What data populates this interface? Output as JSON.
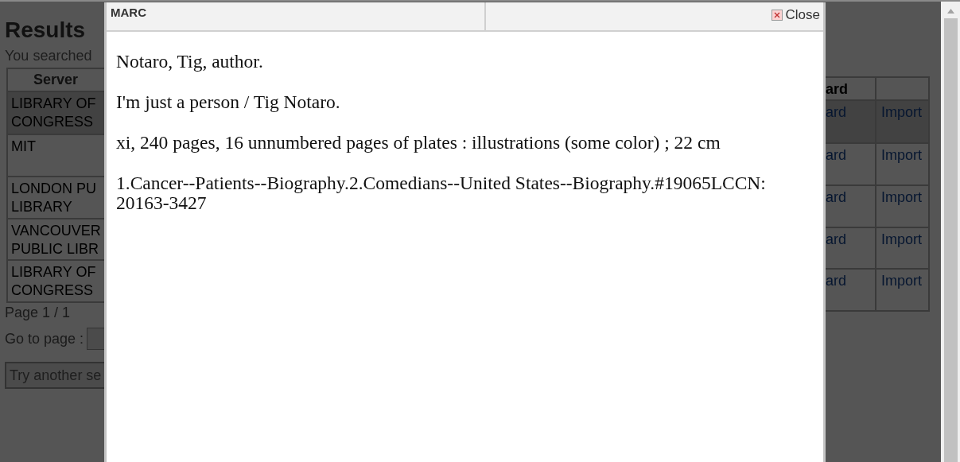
{
  "results": {
    "title": "Results",
    "search_summary": "You searched",
    "columns": {
      "server": "Server",
      "record": "ard"
    },
    "rows": [
      {
        "server": [
          "LIBRARY OF",
          "CONGRESS"
        ],
        "record": "ard",
        "action": "Import",
        "selected": true
      },
      {
        "server": [
          "MIT"
        ],
        "record": "ard",
        "action": "Import",
        "selected": false
      },
      {
        "server": [
          "LONDON PU",
          "LIBRARY"
        ],
        "record": "ard",
        "action": "Import",
        "selected": false
      },
      {
        "server": [
          "VANCOUVER",
          "PUBLIC LIBR"
        ],
        "record": "ard",
        "action": "Import",
        "selected": false
      },
      {
        "server": [
          "LIBRARY OF",
          "CONGRESS"
        ],
        "record": "ard",
        "action": "Import",
        "selected": false
      }
    ],
    "page_info": "Page 1 / 1",
    "go_to_page": "Go to page :",
    "search": {
      "placeholder": "Try another se"
    }
  },
  "dialog": {
    "title": "MARC",
    "close": "Close",
    "paragraphs": [
      "Notaro, Tig, author.",
      "I'm just a person / Tig Notaro.",
      "xi, 240 pages, 16 unnumbered pages of plates : illustrations (some color) ; 22 cm",
      "1.Cancer--Patients--Biography.2.Comedians--United States--Biography.#19065LCCN: 20163-3427"
    ]
  }
}
